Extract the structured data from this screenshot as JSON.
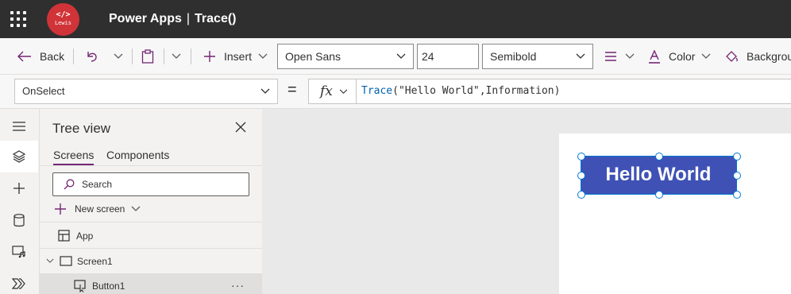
{
  "topbar": {
    "logo_code": "</>",
    "logo_name": "Lewis",
    "app_name": "Power Apps",
    "separator": "|",
    "app_file": "Trace()"
  },
  "commandbar": {
    "back_label": "Back",
    "insert_label": "Insert",
    "font_family": "Open Sans",
    "font_size": "24",
    "font_weight": "Semibold",
    "color_label": "Color",
    "background_label": "Backgrou"
  },
  "formulabar": {
    "property": "OnSelect",
    "equals": "=",
    "fx": "fx",
    "formula_fn": "Trace",
    "formula_args": "(\"Hello World\",Information)"
  },
  "treeview": {
    "title": "Tree view",
    "tabs": [
      "Screens",
      "Components"
    ],
    "search_placeholder": "Search",
    "new_screen_label": "New screen",
    "nodes": [
      "App",
      "Screen1",
      "Button1"
    ],
    "more": "···"
  },
  "canvas": {
    "button_text": "Hello World",
    "button_color": "#3f51b5"
  },
  "colors": {
    "topbar": "#2f2f2f",
    "accent": "#742774",
    "logo": "#d13438",
    "selection": "#0078d4"
  }
}
